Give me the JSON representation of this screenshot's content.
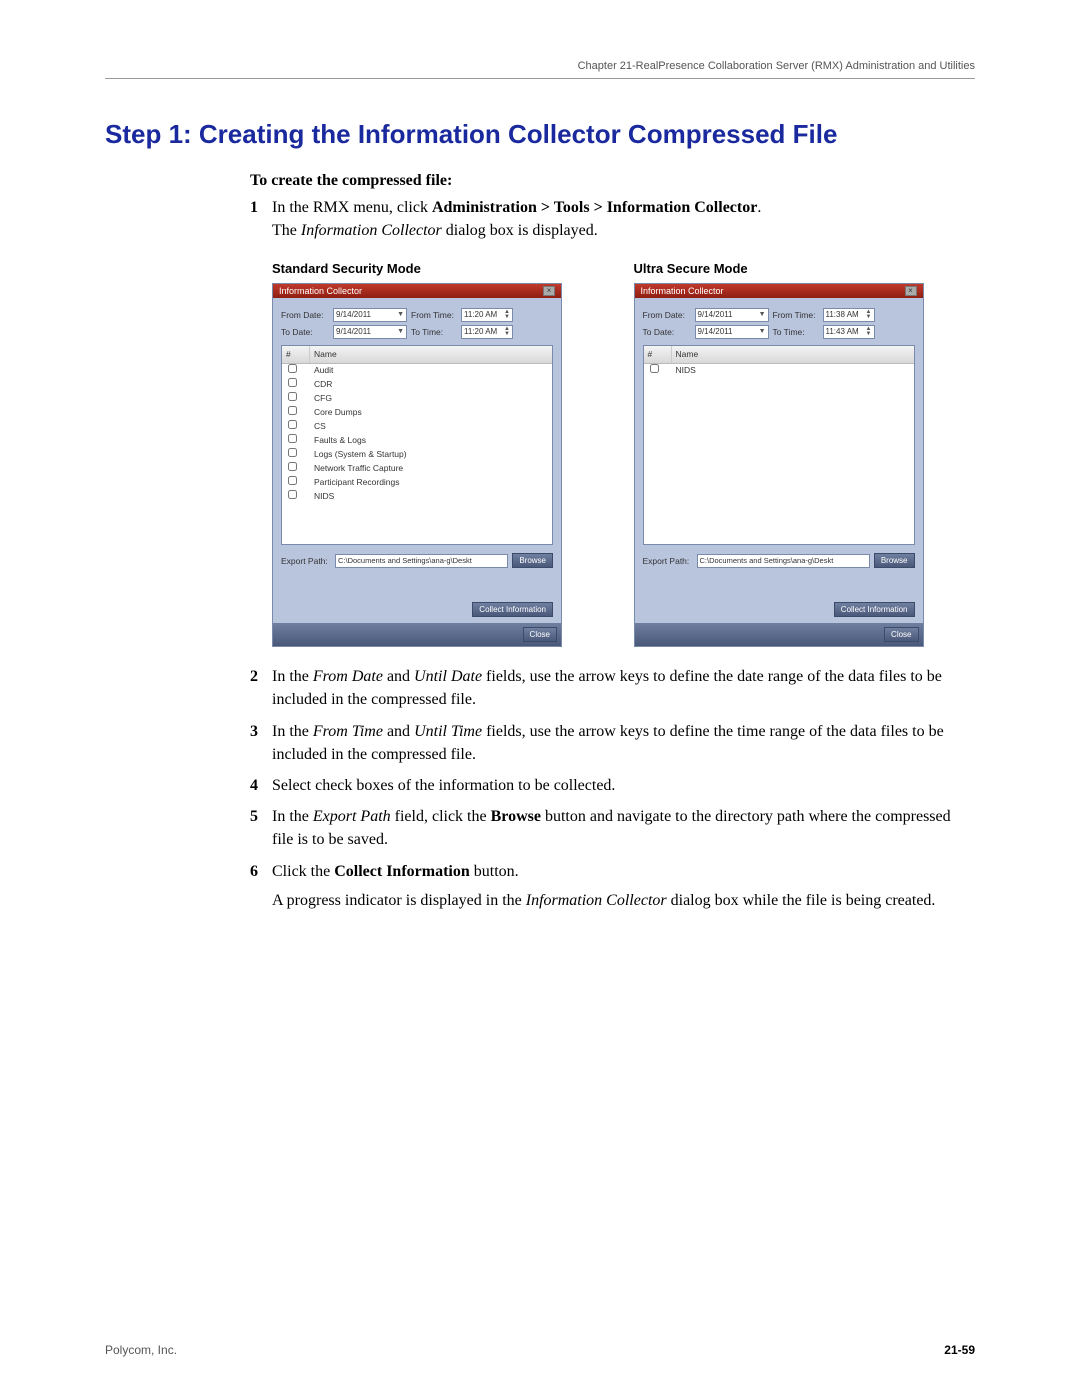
{
  "header": {
    "chapter": "Chapter 21-RealPresence Collaboration Server (RMX) Administration and Utilities"
  },
  "title": "Step 1: Creating the Information Collector Compressed File",
  "subhead": "To create the compressed file:",
  "steps": {
    "s1_a": "In the RMX menu, click ",
    "s1_b": "Administration > Tools > Information Collector",
    "s1_c": ".",
    "s1_d": "The ",
    "s1_e": "Information Collector",
    "s1_f": " dialog box is displayed.",
    "s2_a": "In the ",
    "s2_b": "From Date",
    "s2_c": " and ",
    "s2_d": "Until Date",
    "s2_e": " fields, use the arrow keys to define the date range of the data files to be included in the compressed file.",
    "s3_a": "In the ",
    "s3_b": "From Time",
    "s3_c": " and ",
    "s3_d": "Until Time",
    "s3_e": " fields, use the arrow keys to define the time range of the data files to be included in the compressed file.",
    "s4": "Select check boxes of the information to be collected.",
    "s5_a": "In the ",
    "s5_b": "Export Path",
    "s5_c": " field, click the ",
    "s5_d": "Browse",
    "s5_e": " button and navigate to the directory path where the compressed file is to be saved.",
    "s6_a": "Click the ",
    "s6_b": "Collect Information",
    "s6_c": " button.",
    "s6_sub_a": "A progress indicator is displayed in the ",
    "s6_sub_b": "Information Collector",
    "s6_sub_c": " dialog box while the file is being created."
  },
  "modes": {
    "standard_label": "Standard Security Mode",
    "ultra_label": "Ultra Secure Mode"
  },
  "dialog": {
    "title": "Information Collector",
    "from_date_label": "From Date:",
    "to_date_label": "To Date:",
    "from_time_label": "From Time:",
    "to_time_label": "To Time:",
    "col_hash": "#",
    "col_name": "Name",
    "browse": "Browse",
    "collect": "Collect Information",
    "close": "Close",
    "export_label": "Export Path:"
  },
  "standard_dialog": {
    "from_date": "9/14/2011",
    "to_date": "9/14/2011",
    "from_time": "11:20 AM",
    "to_time": "11:20 AM",
    "items": [
      "Audit",
      "CDR",
      "CFG",
      "Core Dumps",
      "CS",
      "Faults & Logs",
      "Logs (System & Startup)",
      "Network Traffic Capture",
      "Participant Recordings",
      "NIDS"
    ],
    "export_path": "C:\\Documents and Settings\\ana-g\\Deskt"
  },
  "ultra_dialog": {
    "from_date": "9/14/2011",
    "to_date": "9/14/2011",
    "from_time": "11:38 AM",
    "to_time": "11:43 AM",
    "items": [
      "NIDS"
    ],
    "export_path": "C:\\Documents and Settings\\ana-g\\Deskt"
  },
  "footer": {
    "company": "Polycom, Inc.",
    "page": "21-59"
  }
}
